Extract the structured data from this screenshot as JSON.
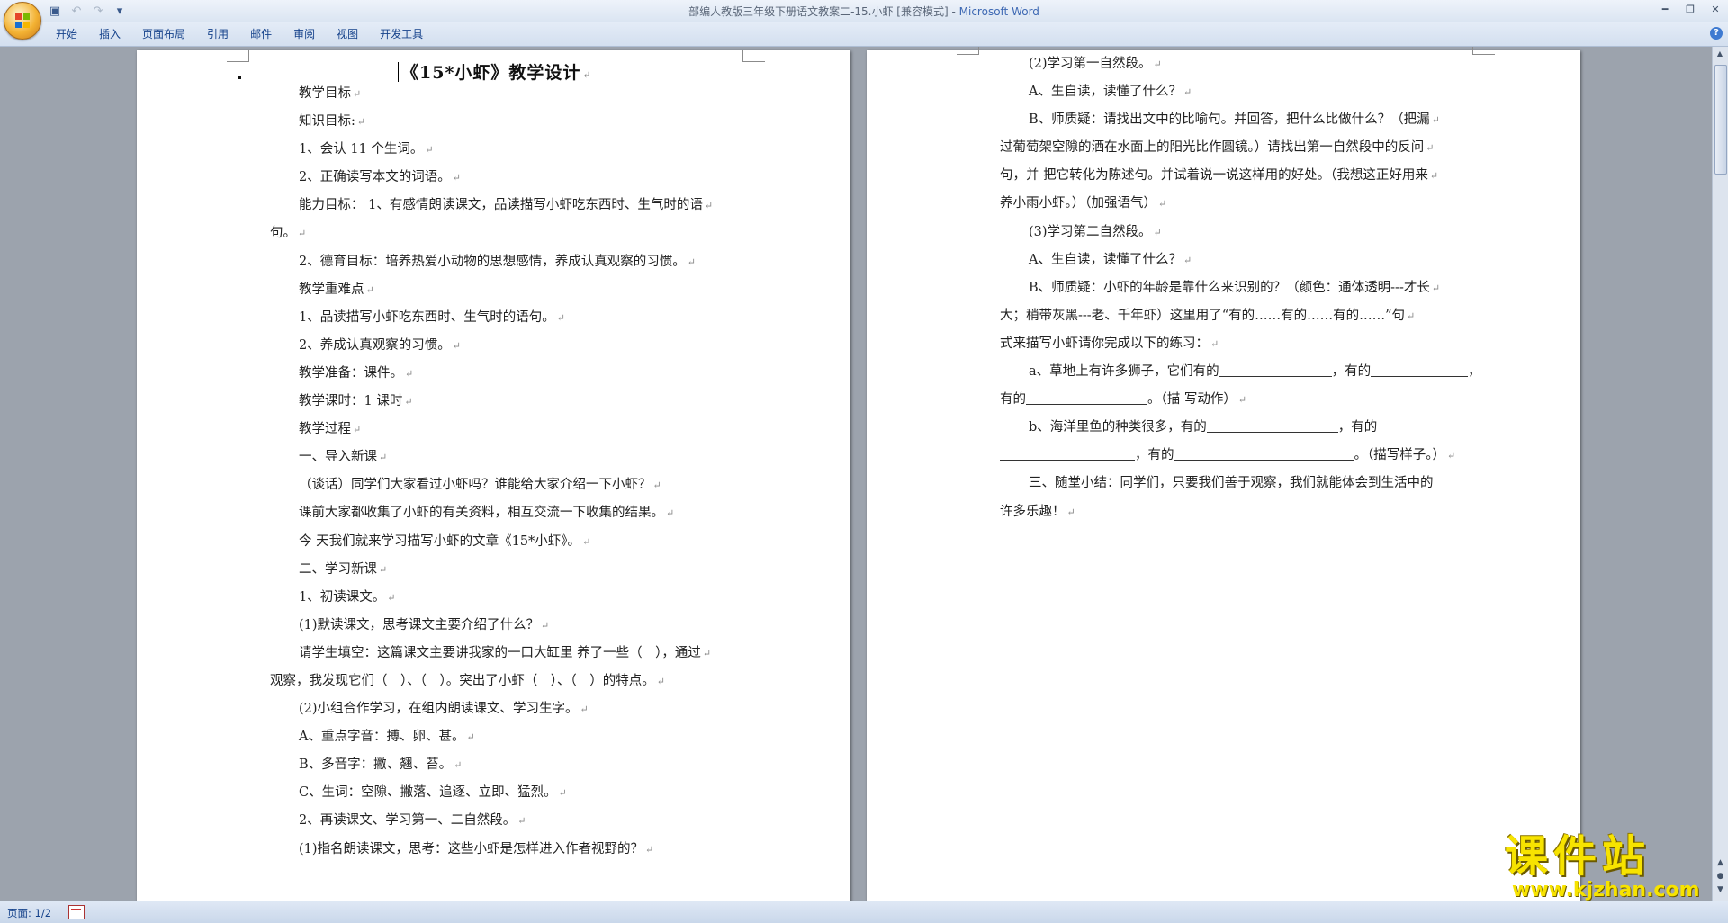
{
  "window": {
    "title": "部编人教版三年级下册语文教案二-15.小虾 [兼容模式]",
    "app_name": "Microsoft Word"
  },
  "quick_access": [
    {
      "icon": "save-icon",
      "glyph": "▣"
    },
    {
      "icon": "undo-icon",
      "glyph": "↶"
    },
    {
      "icon": "redo-icon",
      "glyph": "↷"
    },
    {
      "icon": "customize-icon",
      "glyph": "▾"
    }
  ],
  "ribbon": {
    "tabs": [
      "开始",
      "插入",
      "页面布局",
      "引用",
      "邮件",
      "审阅",
      "视图",
      "开发工具"
    ]
  },
  "page1": {
    "title": "《15*小虾》教学设计",
    "paragraphs": [
      {
        "text": "教学目标",
        "indent": true
      },
      {
        "text": "知识目标:",
        "indent": true
      },
      {
        "text": "1、会认 11 个生词。",
        "indent": true
      },
      {
        "text": "2、正确读写本文的词语。",
        "indent": true
      },
      {
        "text": "能力目标： 1、有感情朗读课文，品读描写小虾吃东西时、生气时的语",
        "indent": true
      },
      {
        "text": "句。",
        "indent": false
      },
      {
        "text": "2、德育目标：培养热爱小动物的思想感情，养成认真观察的习惯。",
        "indent": true
      },
      {
        "text": "教学重难点",
        "indent": true
      },
      {
        "text": "1、品读描写小虾吃东西时、生气时的语句。",
        "indent": true
      },
      {
        "text": "2、养成认真观察的习惯。",
        "indent": true
      },
      {
        "text": "教学准备：课件。",
        "indent": true
      },
      {
        "text": "教学课时：1 课时",
        "indent": true
      },
      {
        "text": "教学过程",
        "indent": true
      },
      {
        "text": "一、导入新课",
        "indent": true
      },
      {
        "text": "（谈话）同学们大家看过小虾吗？谁能给大家介绍一下小虾？",
        "indent": true
      },
      {
        "text": "课前大家都收集了小虾的有关资料，相互交流一下收集的结果。",
        "indent": true
      },
      {
        "text": "今 天我们就来学习描写小虾的文章《15*小虾》。",
        "indent": true
      },
      {
        "text": "二、学习新课",
        "indent": true
      },
      {
        "text": "1、初读课文。",
        "indent": true
      },
      {
        "text": "(1)默读课文，思考课文主要介绍了什么？",
        "indent": true
      },
      {
        "text": "请学生填空：这篇课文主要讲我家的一口大缸里 养了一些（　），通过",
        "indent": true
      },
      {
        "text": "观察，我发现它们（　）、（　）。突出了小虾（　）、（　）的特点。",
        "indent": false
      },
      {
        "text": "(2)小组合作学习，在组内朗读课文、学习生字。",
        "indent": true
      },
      {
        "text": "A、重点字音：搏、卵、甚。",
        "indent": true
      },
      {
        "text": "B、多音字：撇、翘、苔。",
        "indent": true
      },
      {
        "text": "C、生词：空隙、撇落、追逐、立即、猛烈。",
        "indent": true
      },
      {
        "text": "2、再读课文、学习第一、二自然段。",
        "indent": true
      },
      {
        "text": "(1)指名朗读课文，思考：这些小虾是怎样进入作者视野的？",
        "indent": true
      }
    ]
  },
  "page2": {
    "paragraphs": [
      {
        "text": "(2)学习第一自然段。",
        "indent": true
      },
      {
        "text": "A、生自读，读懂了什么？",
        "indent": true
      },
      {
        "text": "B、师质疑：请找出文中的比喻句。并回答，把什么比做什么？（把漏",
        "indent": true
      },
      {
        "text": "过葡萄架空隙的洒在水面上的阳光比作圆镜。）请找出第一自然段中的反问",
        "indent": false
      },
      {
        "text": "句，并 把它转化为陈述句。并试着说一说这样用的好处。（我想这正好用来",
        "indent": false
      },
      {
        "text": "养小雨小虾。）（加强语气）",
        "indent": false
      },
      {
        "text": "(3)学习第二自然段。",
        "indent": true
      },
      {
        "text": "A、生自读，读懂了什么？",
        "indent": true
      },
      {
        "text": "B、师质疑：小虾的年龄是靠什么来识别的？（颜色：通体透明---才长",
        "indent": true
      },
      {
        "text": "大；稍带灰黑---老、千年虾）这里用了“有的……有的……有的……”句",
        "indent": false
      },
      {
        "text": "式来描写小虾请你完成以下的练习：",
        "indent": false
      }
    ],
    "exercise_a": {
      "p1": "a、草地上有许多狮子，它们有的",
      "p2": "，有的",
      "p3": "，",
      "p4": "有的",
      "p5": "。（描 写动作）"
    },
    "exercise_b": {
      "p1": "b、海洋里鱼的种类很多，有的",
      "p2": "，有的",
      "p3": "，有的",
      "p4": "。（描写样子。）"
    },
    "summary_1": "三、随堂小结：同学们，只要我们善于观察，我们就能体会到生活中的",
    "summary_2": "许多乐趣！"
  },
  "statusbar": {
    "page": "页面: 1/2"
  },
  "watermark": {
    "title": "课件站",
    "url": "www.kjzhan.com"
  }
}
